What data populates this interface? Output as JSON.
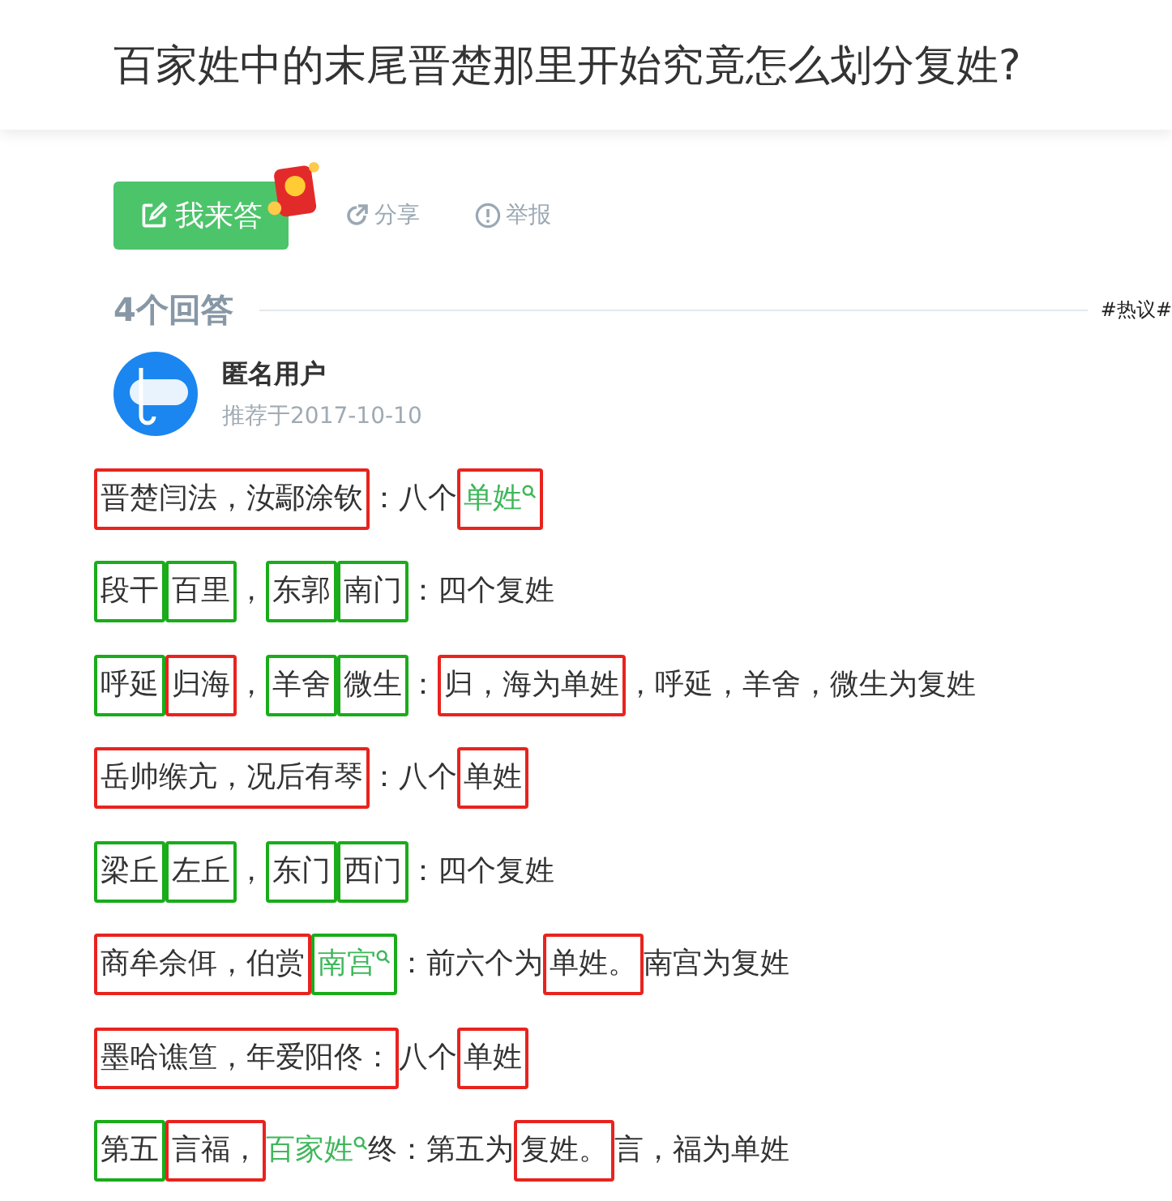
{
  "header": {
    "title": "百家姓中的末尾晋楚那里开始究竟怎么划分复姓?"
  },
  "actions": {
    "answer_button": "我来答",
    "share": "分享",
    "report": "举报"
  },
  "answers_header": {
    "count": "4个回答",
    "tag": "#热议#"
  },
  "answer": {
    "author": "匿名用户",
    "date": "推荐于2017-10-10",
    "lines": [
      [
        {
          "text": "晋楚闫法，汝鄢涂钦",
          "color": "#e8231e"
        },
        {
          "text": "：八个"
        },
        {
          "text": "单姓",
          "link": true,
          "color": "#e8231e"
        }
      ],
      [
        {
          "text": "段干",
          "color": "#1aac1a"
        },
        {
          "text": "百里",
          "color": "#1aac1a"
        },
        {
          "text": "，"
        },
        {
          "text": "东郭",
          "color": "#1aac1a"
        },
        {
          "text": "南门",
          "color": "#1aac1a"
        },
        {
          "text": "：四个复姓"
        }
      ],
      [
        {
          "text": "呼延",
          "color": "#1aac1a"
        },
        {
          "text": "归海",
          "color": "#e8231e"
        },
        {
          "text": "，"
        },
        {
          "text": "羊舍",
          "color": "#1aac1a"
        },
        {
          "text": "微生",
          "color": "#1aac1a"
        },
        {
          "text": "："
        },
        {
          "text": "归，海为单姓",
          "color": "#e8231e"
        },
        {
          "text": "，呼延，羊舍，微生为复姓"
        }
      ],
      [
        {
          "text": "岳帅缑亢，况后有琴",
          "color": "#e8231e"
        },
        {
          "text": "：八个"
        },
        {
          "text": "单姓",
          "color": "#e8231e"
        }
      ],
      [
        {
          "text": "梁丘",
          "color": "#1aac1a"
        },
        {
          "text": "左丘",
          "color": "#1aac1a"
        },
        {
          "text": "，"
        },
        {
          "text": "东门",
          "color": "#1aac1a"
        },
        {
          "text": "西门",
          "color": "#1aac1a"
        },
        {
          "text": "：四个复姓"
        }
      ],
      [
        {
          "text": "商牟佘佴，伯赏",
          "color": "#e8231e"
        },
        {
          "text": "南宫",
          "link": true,
          "color": "#1aac1a"
        },
        {
          "text": "：前六个为"
        },
        {
          "text": "单姓。",
          "color": "#e8231e"
        },
        {
          "text": "南宫为复姓"
        }
      ],
      [
        {
          "text": "墨哈谯笪，年爱阳佟：",
          "color": "#e8231e"
        },
        {
          "text": "八个"
        },
        {
          "text": "单姓",
          "color": "#e8231e"
        }
      ],
      [
        {
          "text": "第五",
          "color": "#1aac1a"
        },
        {
          "text": "言福，",
          "color": "#e8231e"
        },
        {
          "text": "百家姓",
          "link": true
        },
        {
          "text": "终：第五为"
        },
        {
          "text": "复姓。",
          "color": "#e8231e"
        },
        {
          "text": "言，福为单姓"
        }
      ]
    ]
  }
}
